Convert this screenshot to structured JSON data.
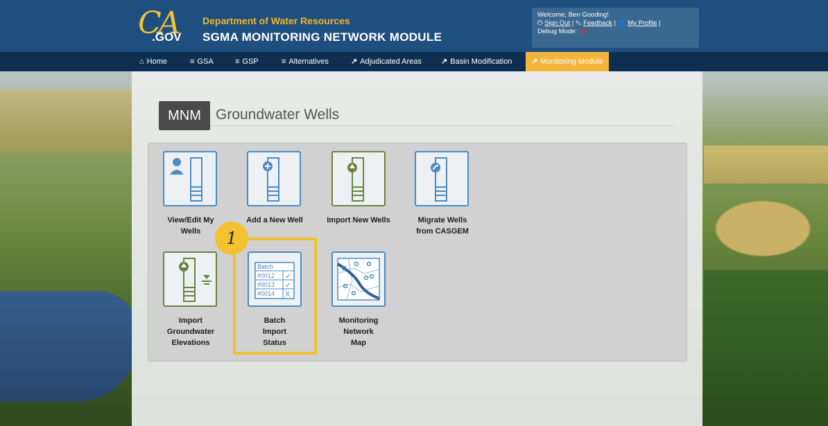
{
  "header": {
    "logo_ca": "CA",
    "logo_gov": ".GOV",
    "department": "Department of Water Resources",
    "module_title": "SGMA MONITORING NETWORK MODULE",
    "welcome": "Welcome, Ben Gooding!",
    "sign_out": "Sign Out",
    "feedback": "Feedback",
    "my_profile": "My Profile",
    "debug_label": "Debug Mode:",
    "debug_value": "Off"
  },
  "nav": {
    "items": [
      {
        "label": "Home",
        "icon": "home-icon"
      },
      {
        "label": "GSA",
        "icon": "menu-icon"
      },
      {
        "label": "GSP",
        "icon": "menu-icon"
      },
      {
        "label": "Alternatives",
        "icon": "menu-icon"
      },
      {
        "label": "Adjudicated Areas",
        "icon": "external-link-icon"
      },
      {
        "label": "Basin Modification",
        "icon": "external-link-icon"
      },
      {
        "label": "Monitoring Module",
        "icon": "external-link-icon",
        "active": true
      }
    ]
  },
  "page": {
    "badge": "MNM",
    "title": "Groundwater Wells"
  },
  "tiles": [
    {
      "label_lines": [
        "View/Edit My",
        "Wells"
      ],
      "icon": "person-well-icon"
    },
    {
      "label_lines": [
        "Add a New Well"
      ],
      "icon": "add-well-icon"
    },
    {
      "label_lines": [
        "Import New Wells"
      ],
      "icon": "import-well-icon"
    },
    {
      "label_lines": [
        "Migrate Wells",
        "from CASGEM"
      ],
      "icon": "migrate-well-icon"
    },
    {
      "label_lines": [
        "Import",
        "Groundwater",
        "Elevations"
      ],
      "icon": "import-elevations-icon"
    },
    {
      "label_lines": [
        "Batch",
        "Import",
        "Status"
      ],
      "icon": "batch-status-icon"
    },
    {
      "label_lines": [
        "Monitoring",
        "Network",
        "Map"
      ],
      "icon": "network-map-icon"
    }
  ],
  "batch_icon": {
    "header": "Batch",
    "rows": [
      "#0012",
      "#0013",
      "#0014"
    ],
    "marks": [
      "✓",
      "✓",
      "X"
    ]
  },
  "annotation": {
    "step": "1"
  },
  "colors": {
    "header_bg": "#1f4f7f",
    "nav_bg": "#0f2f52",
    "accent": "#f2b43a",
    "tile_blue": "#4b8ac7",
    "tile_green": "#6a8240",
    "highlight": "#f2c230"
  }
}
